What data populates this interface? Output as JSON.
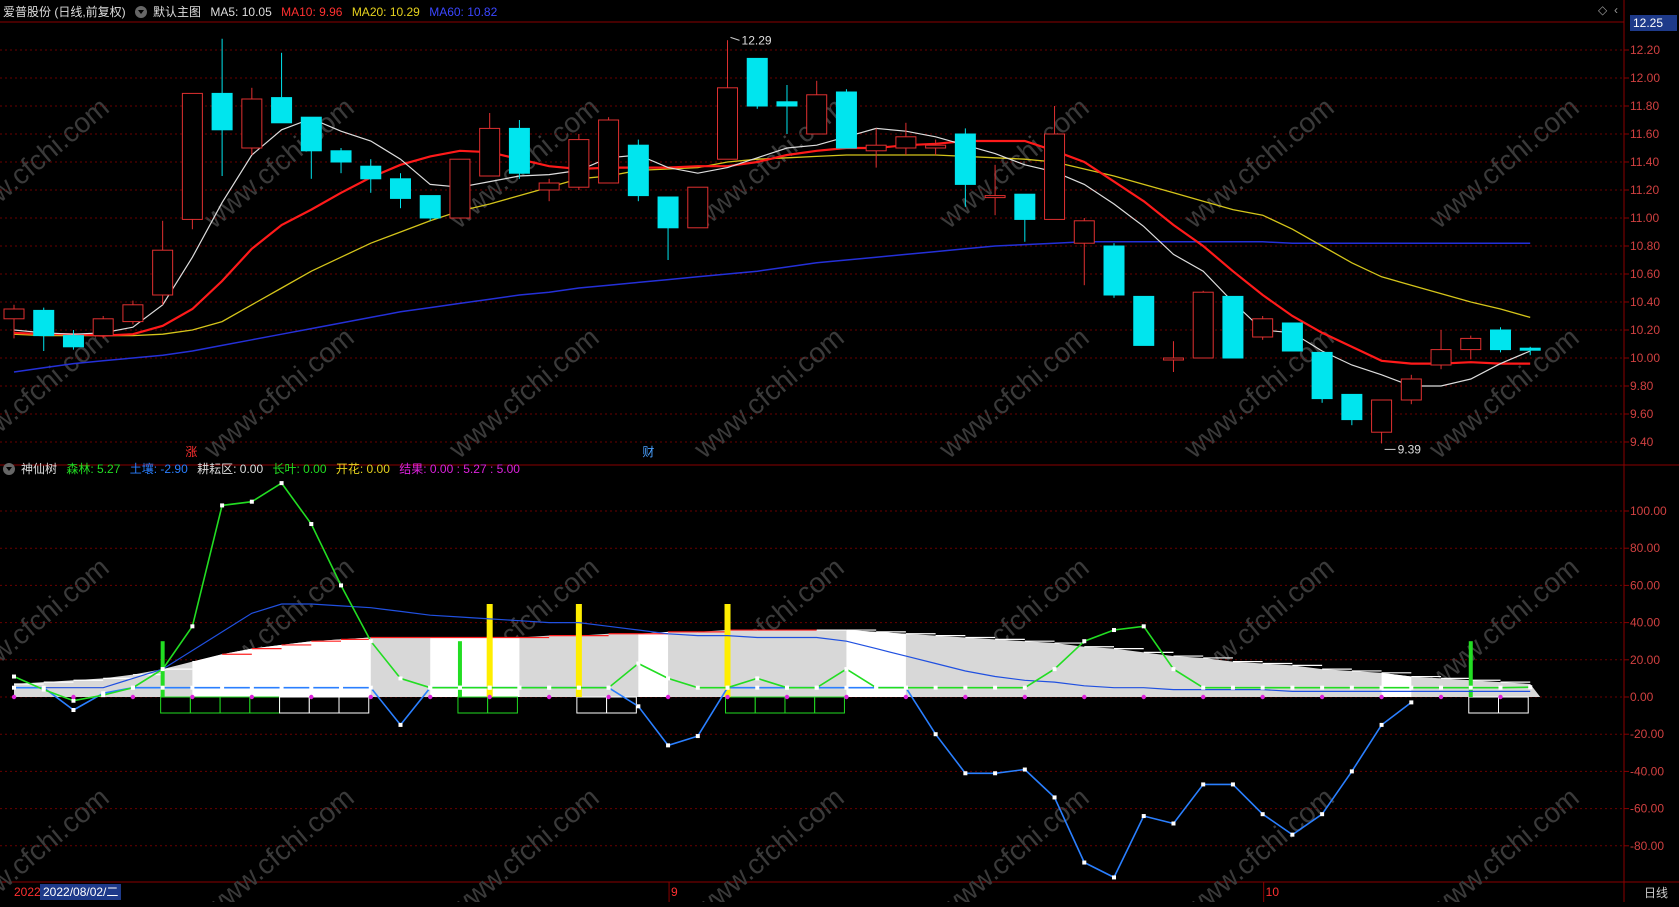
{
  "header": {
    "stock_name": "爱普股份 (日线,前复权)",
    "main_chart_label": "默认主图",
    "ma5": "MA5: 10.05",
    "ma10": "MA10: 9.96",
    "ma20": "MA20: 10.29",
    "ma60": "MA60: 10.82"
  },
  "indicator_header": {
    "name": "神仙树",
    "senlin": "森林: 5.27",
    "turang": "土壤: -2.90",
    "gengyun": "耕耘区: 0.00",
    "zhangye": "长叶: 0.00",
    "kaihua": "开花: 0.00",
    "jieguo": "结果: 0.00 : 5.27 : 5.00"
  },
  "colors": {
    "up": "#e03030",
    "down": "#00e5ee",
    "ma5": "#dddddd",
    "ma10": "#ff1a1a",
    "ma20": "#d4c41a",
    "ma60": "#2430d8",
    "grid": "#6a0000",
    "axis_text": "#d04040",
    "senlin": "#22dd22",
    "turang": "#2a7fff",
    "fill": "#e8e8e8",
    "bar_yellow": "#ffee00",
    "bar_green": "#22dd22"
  },
  "annotations": {
    "high_label": "12.29",
    "low_label": "9.39",
    "marker_zhang": "涨",
    "marker_cai": "财",
    "watermark": "www.cfchi.com"
  },
  "price_axis": {
    "current_price": "12.25",
    "ticks": [
      "12.20",
      "12.00",
      "11.80",
      "11.60",
      "11.40",
      "11.20",
      "11.00",
      "10.80",
      "10.60",
      "10.40",
      "10.20",
      "10.00",
      "9.80",
      "9.60",
      "9.40"
    ]
  },
  "indicator_axis": {
    "ticks": [
      "100.00",
      "80.00",
      "60.00",
      "40.00",
      "20.00",
      "0.00",
      "-20.00",
      "-40.00",
      "-60.00",
      "-80.00"
    ]
  },
  "date_axis": {
    "start_fragment": "2022",
    "selected_date": "2022/08/02/二",
    "month_marks": [
      "9",
      "10"
    ],
    "period_label": "日线"
  },
  "chart_data": [
    {
      "type": "candlestick",
      "ylim": [
        9.3,
        12.4
      ],
      "candles": [
        [
          10.28,
          10.35,
          10.38,
          10.14
        ],
        [
          10.34,
          10.16,
          10.36,
          10.05
        ],
        [
          10.16,
          10.08,
          10.2,
          10.06
        ],
        [
          10.16,
          10.28,
          10.3,
          10.14
        ],
        [
          10.26,
          10.38,
          10.41,
          10.24
        ],
        [
          10.45,
          10.77,
          10.98,
          10.38
        ],
        [
          10.99,
          11.89,
          11.89,
          10.92
        ],
        [
          11.89,
          11.63,
          12.28,
          11.3
        ],
        [
          11.5,
          11.85,
          11.93,
          11.45
        ],
        [
          11.86,
          11.68,
          12.18,
          11.68
        ],
        [
          11.72,
          11.48,
          11.72,
          11.28
        ],
        [
          11.48,
          11.4,
          11.5,
          11.32
        ],
        [
          11.37,
          11.28,
          11.42,
          11.18
        ],
        [
          11.28,
          11.14,
          11.32,
          11.07
        ],
        [
          11.16,
          11.0,
          11.16,
          10.98
        ],
        [
          11.0,
          11.42,
          11.42,
          11.0
        ],
        [
          11.3,
          11.64,
          11.75,
          11.3
        ],
        [
          11.64,
          11.32,
          11.7,
          11.28
        ],
        [
          11.2,
          11.25,
          11.28,
          11.12
        ],
        [
          11.22,
          11.56,
          11.6,
          11.2
        ],
        [
          11.25,
          11.7,
          11.72,
          11.25
        ],
        [
          11.52,
          11.16,
          11.56,
          11.12
        ],
        [
          11.15,
          10.93,
          11.15,
          10.7
        ],
        [
          10.93,
          11.22,
          11.22,
          10.93
        ],
        [
          11.42,
          11.93,
          12.27,
          11.42
        ],
        [
          12.14,
          11.8,
          12.14,
          11.78
        ],
        [
          11.83,
          11.8,
          11.95,
          11.6
        ],
        [
          11.6,
          11.88,
          11.98,
          11.6
        ],
        [
          11.9,
          11.5,
          11.92,
          11.5
        ],
        [
          11.48,
          11.52,
          11.64,
          11.36
        ],
        [
          11.5,
          11.58,
          11.68,
          11.45
        ],
        [
          11.5,
          11.52,
          11.56,
          11.45
        ],
        [
          11.6,
          11.24,
          11.64,
          11.08
        ],
        [
          11.16,
          11.16,
          11.38,
          11.02
        ],
        [
          11.17,
          10.99,
          11.17,
          10.83
        ],
        [
          10.99,
          11.6,
          11.8,
          10.99
        ],
        [
          10.82,
          10.98,
          11.0,
          10.52
        ],
        [
          10.8,
          10.45,
          10.82,
          10.43
        ],
        [
          10.44,
          10.09,
          10.44,
          10.09
        ],
        [
          10.0,
          10.0,
          10.12,
          9.9
        ],
        [
          10.0,
          10.47,
          10.48,
          10.0
        ],
        [
          10.44,
          10.0,
          10.44,
          10.0
        ],
        [
          10.15,
          10.28,
          10.3,
          10.13
        ],
        [
          10.25,
          10.05,
          10.25,
          10.05
        ],
        [
          10.04,
          9.71,
          10.04,
          9.68
        ],
        [
          9.74,
          9.56,
          9.74,
          9.52
        ],
        [
          9.47,
          9.7,
          9.7,
          9.39
        ],
        [
          9.7,
          9.85,
          9.88,
          9.67
        ],
        [
          9.95,
          10.06,
          10.2,
          9.92
        ],
        [
          10.06,
          10.14,
          10.16,
          9.99
        ],
        [
          10.2,
          10.06,
          10.22,
          10.04
        ],
        [
          10.07,
          10.06,
          10.08,
          10.02
        ]
      ],
      "ma5": [
        10.2,
        10.18,
        10.17,
        10.18,
        10.22,
        10.38,
        10.72,
        11.11,
        11.45,
        11.63,
        11.71,
        11.62,
        11.55,
        11.42,
        11.24,
        11.22,
        11.26,
        11.3,
        11.31,
        11.34,
        11.43,
        11.45,
        11.36,
        11.32,
        11.36,
        11.43,
        11.5,
        11.52,
        11.58,
        11.64,
        11.62,
        11.58,
        11.52,
        11.46,
        11.38,
        11.33,
        11.24,
        11.1,
        10.94,
        10.74,
        10.62,
        10.4,
        10.2,
        10.18,
        10.05,
        9.95,
        9.88,
        9.8,
        9.8,
        9.85,
        9.96,
        10.05
      ],
      "ma10": [
        10.18,
        10.17,
        10.17,
        10.16,
        10.17,
        10.23,
        10.35,
        10.55,
        10.78,
        10.95,
        11.06,
        11.18,
        11.29,
        11.38,
        11.44,
        11.48,
        11.47,
        11.42,
        11.37,
        11.35,
        11.36,
        11.36,
        11.36,
        11.37,
        11.37,
        11.4,
        11.45,
        11.48,
        11.5,
        11.5,
        11.52,
        11.53,
        11.55,
        11.55,
        11.55,
        11.48,
        11.4,
        11.26,
        11.12,
        10.95,
        10.8,
        10.62,
        10.45,
        10.3,
        10.18,
        10.08,
        9.98,
        9.96,
        9.96,
        9.97,
        9.96,
        9.96
      ],
      "ma20": [
        10.17,
        10.16,
        10.16,
        10.16,
        10.16,
        10.17,
        10.2,
        10.26,
        10.38,
        10.5,
        10.62,
        10.72,
        10.82,
        10.9,
        10.98,
        11.05,
        11.1,
        11.16,
        11.22,
        11.28,
        11.3,
        11.34,
        11.35,
        11.36,
        11.4,
        11.42,
        11.43,
        11.44,
        11.45,
        11.45,
        11.45,
        11.45,
        11.44,
        11.43,
        11.42,
        11.4,
        11.35,
        11.3,
        11.24,
        11.18,
        11.12,
        11.06,
        11.02,
        10.92,
        10.8,
        10.68,
        10.58,
        10.52,
        10.46,
        10.4,
        10.35,
        10.29
      ],
      "ma60": [
        9.9,
        9.93,
        9.96,
        9.98,
        10.0,
        10.02,
        10.05,
        10.09,
        10.13,
        10.17,
        10.21,
        10.25,
        10.29,
        10.33,
        10.36,
        10.39,
        10.42,
        10.45,
        10.47,
        10.5,
        10.52,
        10.54,
        10.56,
        10.58,
        10.6,
        10.62,
        10.65,
        10.68,
        10.7,
        10.72,
        10.74,
        10.76,
        10.78,
        10.8,
        10.81,
        10.82,
        10.83,
        10.83,
        10.83,
        10.83,
        10.83,
        10.83,
        10.83,
        10.82,
        10.82,
        10.82,
        10.82,
        10.82,
        10.82,
        10.82,
        10.82,
        10.82
      ]
    },
    {
      "type": "line",
      "ylim": [
        -100,
        120
      ],
      "series": [
        {
          "name": "森林",
          "values": [
            11,
            4,
            -2,
            1,
            5,
            15,
            38,
            103,
            105,
            115,
            93,
            60,
            30,
            10,
            5,
            5,
            5,
            5,
            5,
            5,
            5,
            18,
            10,
            5,
            5,
            10,
            5,
            5,
            15,
            5,
            5,
            5,
            5,
            5,
            5,
            15,
            30,
            36,
            38,
            15,
            5,
            5,
            5,
            5,
            5,
            5,
            5,
            5,
            5,
            5,
            5,
            5.27
          ]
        },
        {
          "name": "土壤",
          "values": [
            5,
            5,
            -7,
            2,
            5,
            5,
            5,
            5,
            5,
            5,
            5,
            5,
            5,
            -15,
            5,
            5,
            5,
            5,
            5,
            5,
            5,
            -5,
            -26,
            -21,
            5,
            5,
            5,
            5,
            5,
            5,
            5,
            -20,
            -41,
            -41,
            -39,
            -54,
            -89,
            -97,
            -64,
            -68,
            -47,
            -47,
            -63,
            -74,
            -63,
            -40,
            -15,
            -2.9
          ]
        },
        {
          "name": "",
          "values": [
            5,
            5,
            5,
            5,
            10,
            15,
            25,
            35,
            45,
            50,
            50,
            49,
            48,
            46,
            44,
            43,
            42,
            41,
            40,
            40,
            38,
            36,
            34,
            33,
            33,
            32,
            32,
            32,
            30,
            26,
            22,
            18,
            14,
            11,
            9,
            8,
            6,
            5,
            5,
            4,
            4,
            4,
            4,
            3,
            3,
            3,
            3,
            3,
            3,
            3,
            3,
            3
          ]
        }
      ],
      "gray_fill": [
        7,
        8,
        9,
        10,
        12,
        15,
        19,
        23,
        26,
        28,
        30,
        31,
        32,
        32,
        32,
        32,
        32,
        32,
        33,
        33,
        34,
        34,
        35,
        35,
        36,
        36,
        36,
        36,
        36,
        35,
        34,
        33,
        32,
        31,
        30,
        29,
        27,
        26,
        24,
        22,
        21,
        19,
        18,
        17,
        15,
        14,
        13,
        11,
        10,
        9,
        8,
        7
      ],
      "white_bands": [
        [
          6,
          12
        ],
        [
          14,
          17
        ],
        [
          21,
          22
        ],
        [
          28,
          30
        ],
        [
          46,
          47
        ]
      ],
      "yellow_bars": [
        {
          "x": 16,
          "value": 50
        },
        {
          "x": 19,
          "value": 50
        },
        {
          "x": 24,
          "value": 50
        }
      ],
      "green_bars": [
        {
          "x": 5,
          "value": 30
        },
        {
          "x": 15,
          "value": 30
        },
        {
          "x": 49,
          "value": 30
        }
      ]
    }
  ]
}
